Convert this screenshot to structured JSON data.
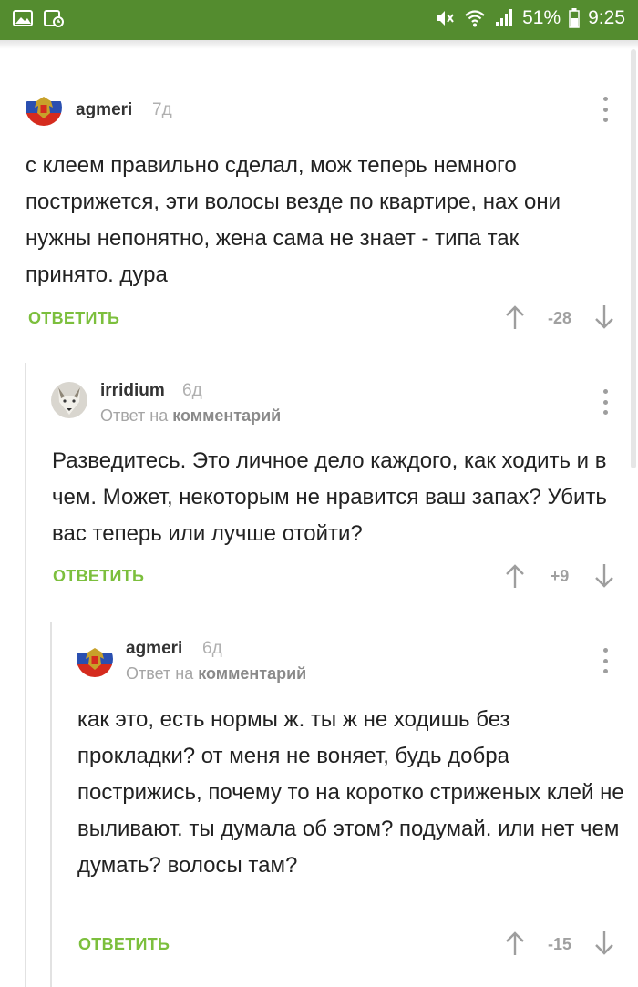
{
  "status_bar": {
    "battery_text": "51%",
    "time": "9:25",
    "icons": [
      "gallery-icon",
      "calendar-icon",
      "mute-icon",
      "wifi-icon",
      "signal-icon",
      "battery-icon"
    ],
    "color": "#548c2f"
  },
  "comments": [
    {
      "author": "agmeri",
      "age": "7д",
      "reply_prefix": "",
      "reply_target": "",
      "text": "с клеем правильно сделал, мож теперь немного пострижется, эти волосы везде по квартире, нах они нужны непонятно, жена сама не знает - типа так принято. дура",
      "reply_label": "ОТВЕТИТЬ",
      "score": "-28"
    },
    {
      "author": "irridium",
      "age": "6д",
      "reply_prefix": "Ответ на",
      "reply_target": "комментарий",
      "text": "Разведитесь. Это личное дело каждого, как ходить и в чем. Может, некоторым не нравится ваш запах? Убить вас теперь или лучше отойти?",
      "reply_label": "ОТВЕТИТЬ",
      "score": "+9"
    },
    {
      "author": "agmeri",
      "age": "6д",
      "reply_prefix": "Ответ на",
      "reply_target": "комментарий",
      "text": "как это, есть нормы ж. ты  ж не ходишь без прокладки? от меня не воняет, будь добра пострижись, почему то на коротко стриженых  клей не выливают. ты думала об этом? подумай. или нет чем думать? волосы там?",
      "reply_label": "ОТВЕТИТЬ",
      "score": "-15"
    }
  ],
  "colors": {
    "accent_green": "#7cbf3d",
    "status_green": "#548c2f",
    "muted": "#a0a0a0"
  }
}
